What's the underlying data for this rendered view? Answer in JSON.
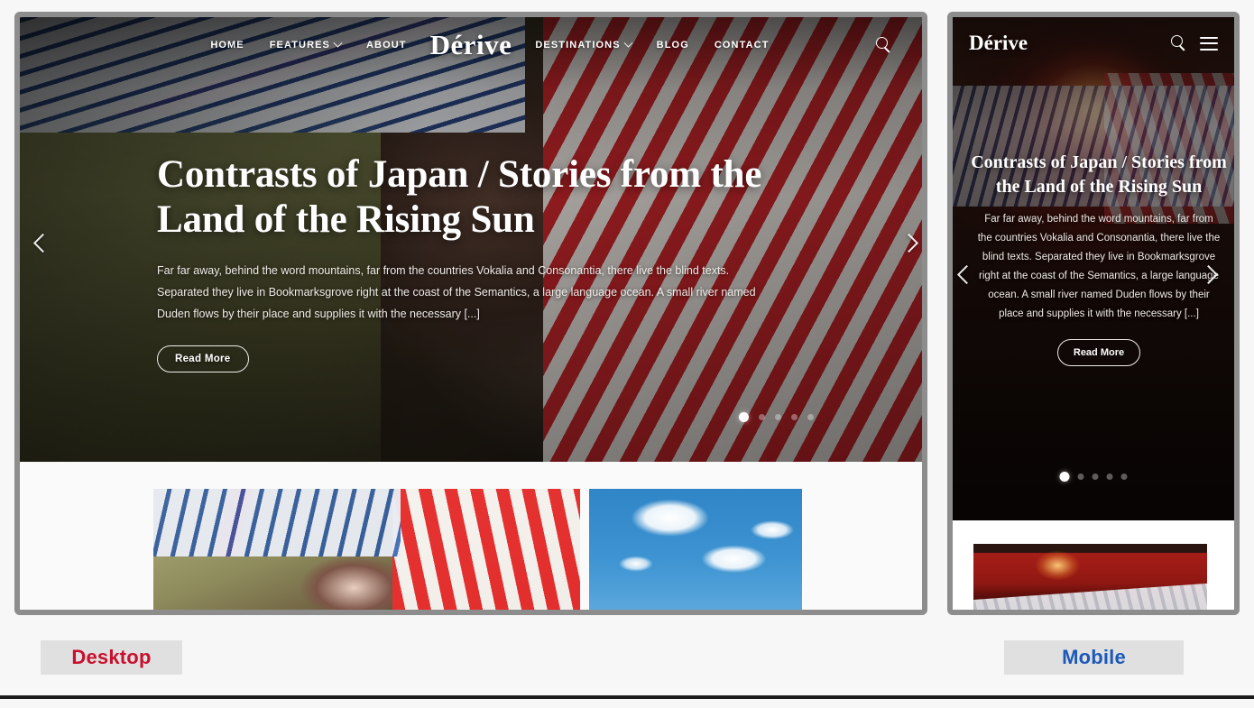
{
  "site": {
    "brand": "Dérive",
    "nav_left": [
      {
        "label": "HOME",
        "has_dropdown": false
      },
      {
        "label": "FEATURES",
        "has_dropdown": true
      },
      {
        "label": "ABOUT",
        "has_dropdown": false
      }
    ],
    "nav_right": [
      {
        "label": "DESTINATIONS",
        "has_dropdown": true
      },
      {
        "label": "BLOG",
        "has_dropdown": false
      },
      {
        "label": "CONTACT",
        "has_dropdown": false
      }
    ],
    "search_icon": "search-icon",
    "menu_icon": "hamburger-menu-icon"
  },
  "hero": {
    "title": "Contrasts of Japan / Stories from the Land of the Rising Sun",
    "description": "Far far away, behind the word mountains, far from the countries Vokalia and Consonantia, there live the blind texts. Separated they live in Bookmarksgrove right at the coast of the Semantics, a large language ocean. A small river named Duden flows by their place and supplies it with the necessary [...]",
    "cta_label": "Read More",
    "prev_icon": "chevron-left-icon",
    "next_icon": "chevron-right-icon",
    "slide_count": 5,
    "active_slide": 1
  },
  "thumbnails": {
    "desktop": [
      {
        "name": "striped-umbrellas-photo"
      },
      {
        "name": "blue-sky-clouds-photo"
      }
    ],
    "mobile": [
      {
        "name": "red-lantern-shopfront-photo"
      }
    ]
  },
  "toggles": {
    "desktop_label": "Desktop",
    "desktop_color": "#c8102e",
    "mobile_label": "Mobile",
    "mobile_color": "#1c58b8"
  }
}
